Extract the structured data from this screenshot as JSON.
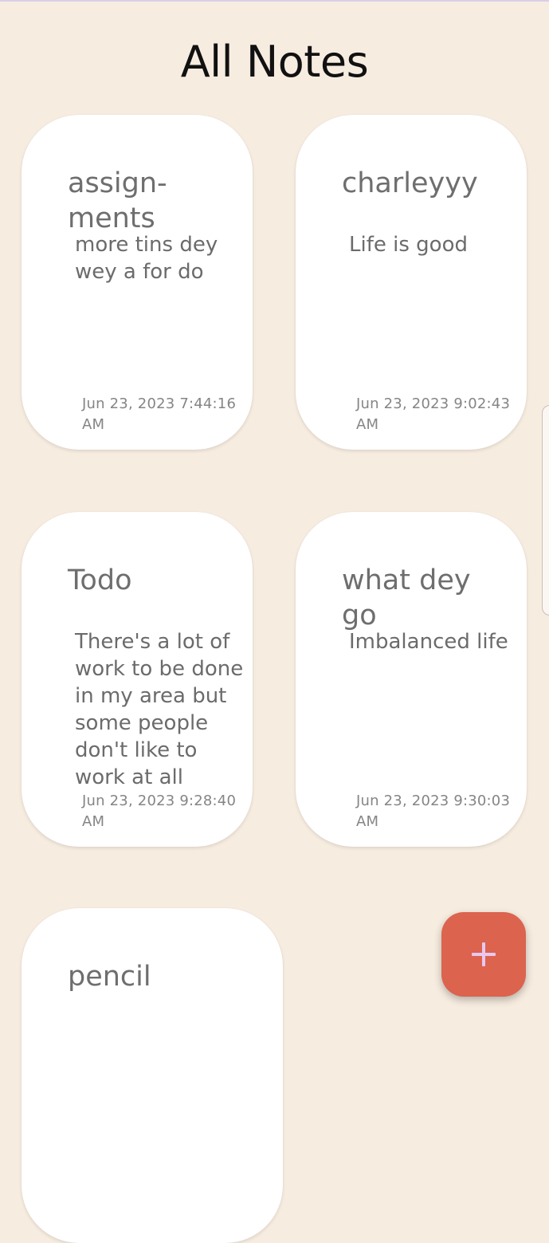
{
  "header": {
    "title": "All Notes"
  },
  "notes": [
    {
      "title": "assign-ments",
      "body": "more tins dey wey a for do",
      "date": "Jun 23, 2023 7:44:16 AM"
    },
    {
      "title": "charleyyy",
      "body": "Life is good",
      "date": "Jun 23, 2023 9:02:43 AM"
    },
    {
      "title": "Todo",
      "body": "There's a lot of work to be done in my area but some people don't like to work at all",
      "date": "Jun 23, 2023 9:28:40 AM"
    },
    {
      "title": "what dey go",
      "body": "Imbalanced life",
      "date": "Jun 23, 2023 9:30:03 AM"
    },
    {
      "title": "pencil",
      "body": "",
      "date": ""
    }
  ],
  "fab": {
    "icon": "plus-icon"
  },
  "colors": {
    "background": "#f7ece0",
    "card": "#ffffff",
    "fab": "#dc634e",
    "fab_icon": "#e8c8f0",
    "title": "#111111",
    "note_text": "#6e6e6e"
  }
}
